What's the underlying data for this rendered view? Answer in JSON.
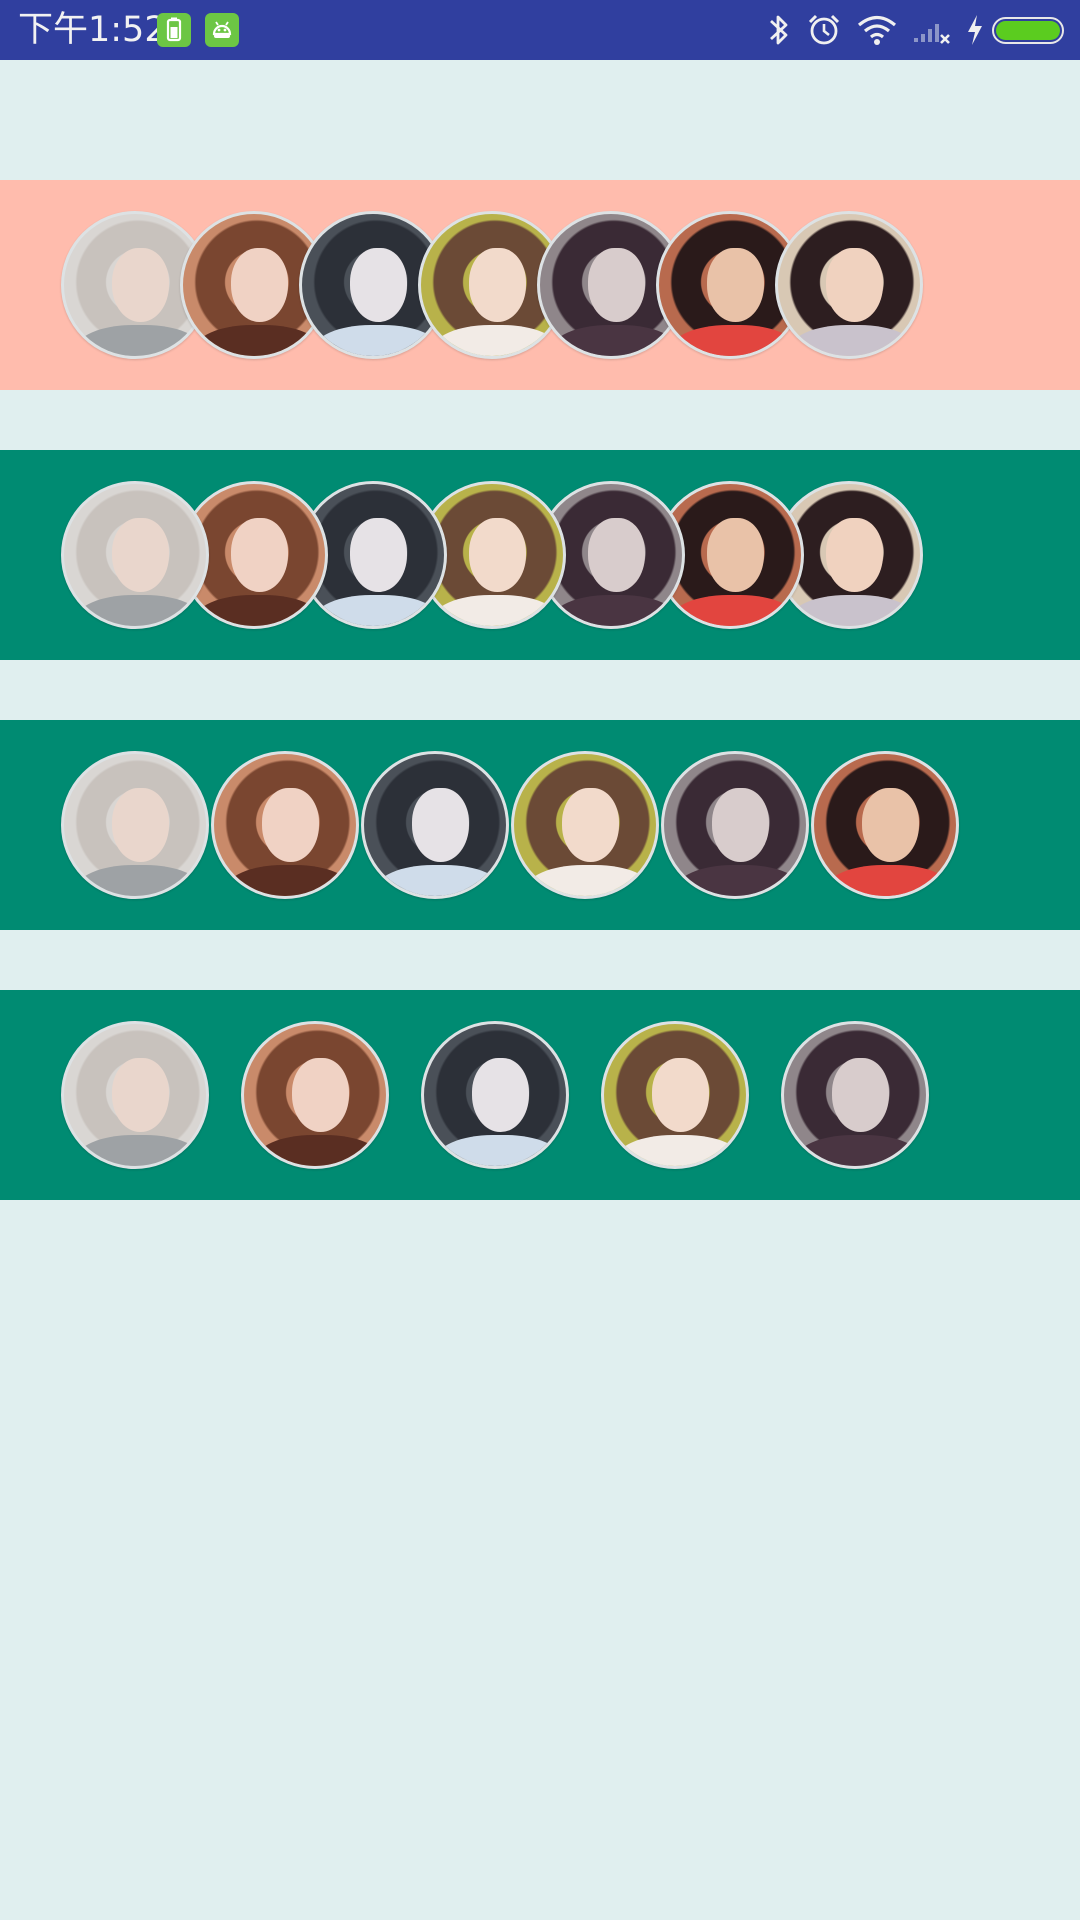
{
  "status_bar": {
    "time": "下午1:52",
    "background": "#303f9f",
    "icons": [
      "battery-app-icon",
      "android-app-icon",
      "bluetooth-icon",
      "alarm-icon",
      "wifi-icon",
      "signal-no-sim-icon",
      "charging-icon",
      "battery-icon"
    ],
    "battery_level": 1.0
  },
  "rows": [
    {
      "name": "avatar-row-overlap-left",
      "background": "#ffbcad",
      "avatars": [
        "avatar-1",
        "avatar-2",
        "avatar-3",
        "avatar-4",
        "avatar-5",
        "avatar-6",
        "avatar-7"
      ]
    },
    {
      "name": "avatar-row-overlap-right",
      "background": "#008b72",
      "avatars": [
        "avatar-1",
        "avatar-2",
        "avatar-3",
        "avatar-4",
        "avatar-5",
        "avatar-6",
        "avatar-7"
      ]
    },
    {
      "name": "avatar-row-touching",
      "background": "#008b72",
      "avatars": [
        "avatar-1",
        "avatar-2",
        "avatar-3",
        "avatar-4",
        "avatar-5",
        "avatar-6"
      ]
    },
    {
      "name": "avatar-row-spaced",
      "background": "#008b72",
      "avatars": [
        "avatar-1",
        "avatar-2",
        "avatar-3",
        "avatar-4",
        "avatar-5"
      ]
    }
  ],
  "page_background": "#e0efef"
}
